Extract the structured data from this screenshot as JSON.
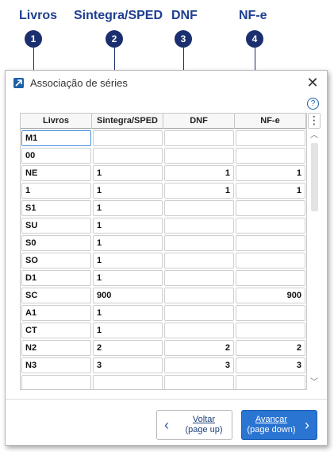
{
  "callouts": [
    {
      "label": "Livros",
      "number": "1"
    },
    {
      "label": "Sintegra/SPED",
      "number": "2"
    },
    {
      "label": "DNF",
      "number": "3"
    },
    {
      "label": "NF-e",
      "number": "4"
    }
  ],
  "window": {
    "title": "Associação de séries",
    "close": "✕",
    "help": "?"
  },
  "grid": {
    "columns": [
      "Livros",
      "Sintegra/SPED",
      "DNF",
      "NF-e"
    ],
    "more": "⋮",
    "rows": [
      [
        "M1",
        "",
        "",
        ""
      ],
      [
        "00",
        "",
        "",
        ""
      ],
      [
        "NE",
        "1",
        "1",
        "1"
      ],
      [
        "1",
        "1",
        "1",
        "1"
      ],
      [
        "S1",
        "1",
        "",
        ""
      ],
      [
        "SU",
        "1",
        "",
        ""
      ],
      [
        "S0",
        "1",
        "",
        ""
      ],
      [
        "SO",
        "1",
        "",
        ""
      ],
      [
        "D1",
        "1",
        "",
        ""
      ],
      [
        "SC",
        "900",
        "",
        "900"
      ],
      [
        "A1",
        "1",
        "",
        ""
      ],
      [
        "CT",
        "1",
        "",
        ""
      ],
      [
        "N2",
        "2",
        "2",
        "2"
      ],
      [
        "N3",
        "3",
        "3",
        "3"
      ],
      [
        "",
        "",
        "",
        ""
      ]
    ],
    "scroll_up": "︿",
    "scroll_down": "﹀"
  },
  "buttons": {
    "back": {
      "line1": "Voltar",
      "line2": "(page up)",
      "arrow": "‹"
    },
    "next": {
      "line1": "Avançar",
      "line2": "(page down)",
      "arrow": "›"
    }
  }
}
